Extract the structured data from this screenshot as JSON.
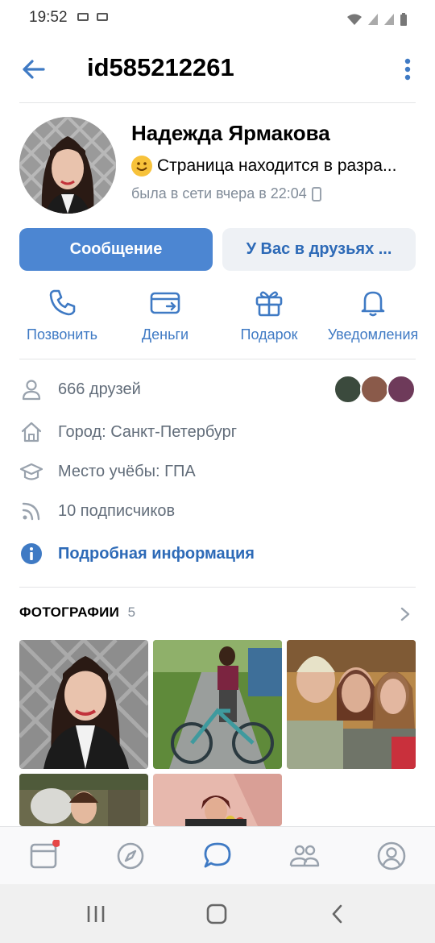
{
  "status_bar": {
    "time": "19:52"
  },
  "header": {
    "title": "id585212261"
  },
  "profile": {
    "name": "Надежда Ярмакова",
    "status": "Страница находится в разра...",
    "last_seen": "была в сети вчера в 22:04",
    "message_button": "Сообщение",
    "friends_button": "У Вас в друзьях ..."
  },
  "actions": [
    {
      "label": "Позвонить",
      "icon": "phone-icon"
    },
    {
      "label": "Деньги",
      "icon": "money-icon"
    },
    {
      "label": "Подарок",
      "icon": "gift-icon"
    },
    {
      "label": "Уведомления",
      "icon": "bell-icon"
    }
  ],
  "info": {
    "friends": "666 друзей",
    "city": "Город: Санкт-Петербург",
    "school": "Место учёбы: ГПА",
    "followers": "10 подписчиков",
    "more": "Подробная информация"
  },
  "photos": {
    "title": "ФОТОГРАФИИ",
    "count": "5"
  },
  "tabs": [
    "feed-icon",
    "discover-icon",
    "messages-icon",
    "friends-icon",
    "profile-icon"
  ],
  "colors": {
    "accent": "#4c86d2",
    "link": "#2d6ab7",
    "secondary_text": "#818c99",
    "notify_dot": "#e64646"
  }
}
